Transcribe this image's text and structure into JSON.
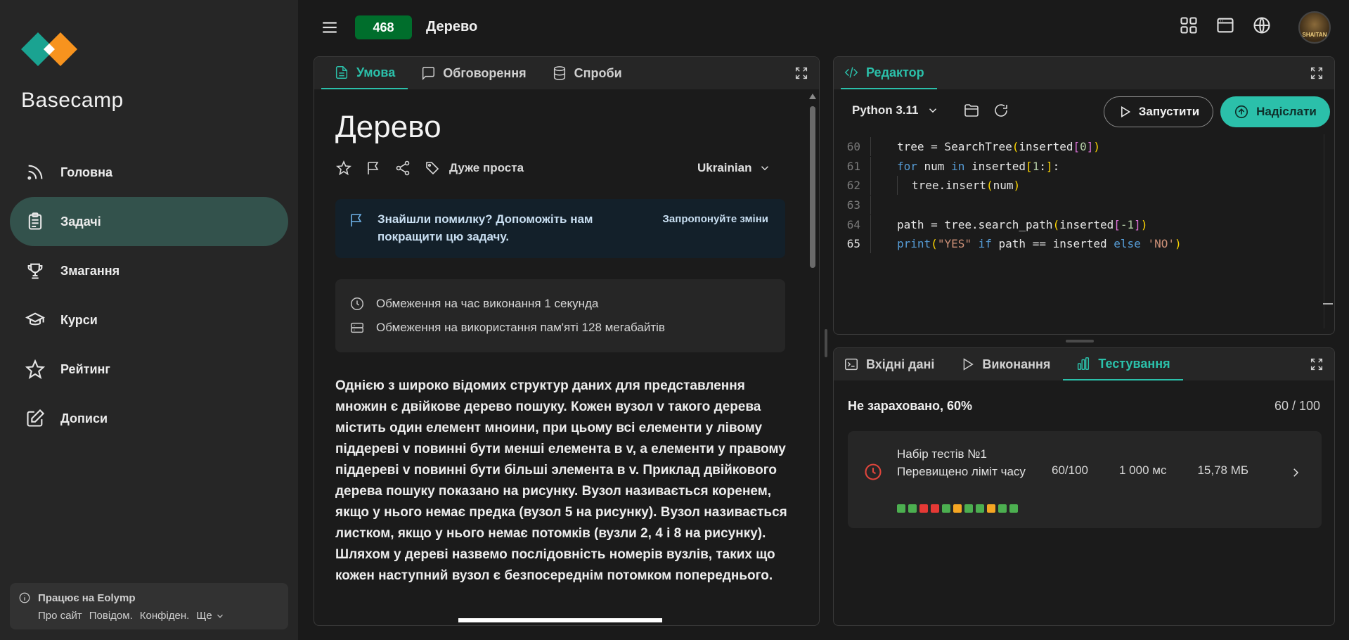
{
  "sidebar": {
    "brand": "Basecamp",
    "items": [
      {
        "label": "Головна",
        "icon": "rss-icon",
        "active": false
      },
      {
        "label": "Задачі",
        "icon": "clipboard-icon",
        "active": true
      },
      {
        "label": "Змагання",
        "icon": "trophy-icon",
        "active": false
      },
      {
        "label": "Курси",
        "icon": "graduation-cap-icon",
        "active": false
      },
      {
        "label": "Рейтинг",
        "icon": "star-icon",
        "active": false
      },
      {
        "label": "Дописи",
        "icon": "edit-icon",
        "active": false
      }
    ],
    "footer": {
      "title": "Працює на Eolymp",
      "links": [
        "Про сайт",
        "Повідом.",
        "Конфіден.",
        "Ще"
      ]
    }
  },
  "header": {
    "problem_id": "468",
    "title": "Дерево"
  },
  "problem_panel": {
    "tabs": [
      "Умова",
      "Обговорення",
      "Спроби"
    ],
    "title": "Дерево",
    "difficulty": "Дуже проста",
    "language": "Ukrainian",
    "notice": {
      "text": "Знайшли помилку? Допоможіть нам покращити цю задачу.",
      "link": "Запропонуйте зміни"
    },
    "limits": {
      "time": "Обмеження на час виконання 1 секунда",
      "memory": "Обмеження на використання пам'яті 128 мегабайтів"
    },
    "description": "Однією з широко відомих структур даних для представлення множин є двійкове дерево пошуку. Кожен вузол v такого дерева містить один елемент мноини, при цьому всі елементи у лівому піддереві v повинні бути менші елемента в v, а елементи у правому піддереві v повинні бути більші элемента в v. Приклад двійкового дерева пошуку показано на рисунку. Вузол називається коренем, якщо у нього немає предка (вузол 5 на рисунку). Вузол називається листком, якщо у нього немає потомків (вузли 2, 4 і 8 на рисунку). Шляхом у дереві назвемо послідовність номерів вузлів, таких що кожен наступний вузол є безпосереднім потомком попереднього."
  },
  "editor_panel": {
    "tab": "Редактор",
    "language": "Python 3.11",
    "run_label": "Запустити",
    "submit_label": "Надіслати",
    "lines": [
      60,
      61,
      62,
      63,
      64,
      65
    ],
    "current_line": 65
  },
  "test_panel": {
    "tabs": [
      "Вхідні дані",
      "Виконання",
      "Тестування"
    ],
    "status": "Не зараховано, 60%",
    "score": "60 / 100",
    "test_set": {
      "name": "Набір тестів №1",
      "verdict": "Перевищено ліміт часу",
      "points": "60/100",
      "time": "1 000 мс",
      "memory": "15,78 МБ",
      "tests": [
        "pass",
        "pass",
        "fail",
        "fail",
        "pass",
        "tle",
        "pass",
        "pass",
        "tle",
        "pass",
        "pass"
      ]
    }
  },
  "colors": {
    "accent": "#2bc0aa",
    "badge": "#006e2c",
    "pass": "#4caf50",
    "fail": "#e53935",
    "tle": "#f5a623"
  }
}
